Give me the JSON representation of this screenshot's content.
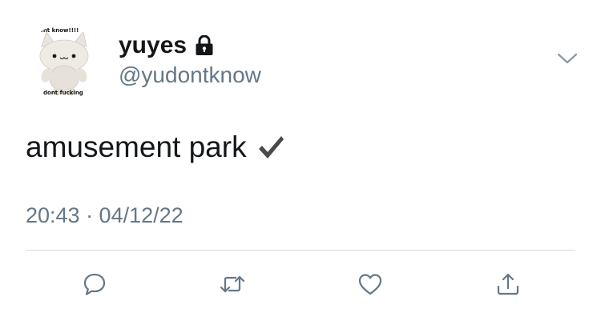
{
  "tweet": {
    "avatar": {
      "caption_top": "dont know!!!!",
      "caption_bottom": "dont fucking"
    },
    "display_name": "yuyes",
    "protected_icon": "lock-icon",
    "username": "@yudontknow",
    "text": "amusement park",
    "text_emoji": "check-mark-icon",
    "timestamp": "20:43 · 04/12/22"
  },
  "actions": [
    {
      "icon": "reply-icon"
    },
    {
      "icon": "retweet-icon"
    },
    {
      "icon": "like-icon"
    },
    {
      "icon": "share-icon"
    }
  ],
  "colors": {
    "primary_text": "#14171a",
    "secondary_text": "#657786",
    "divider": "#d8dde1"
  }
}
